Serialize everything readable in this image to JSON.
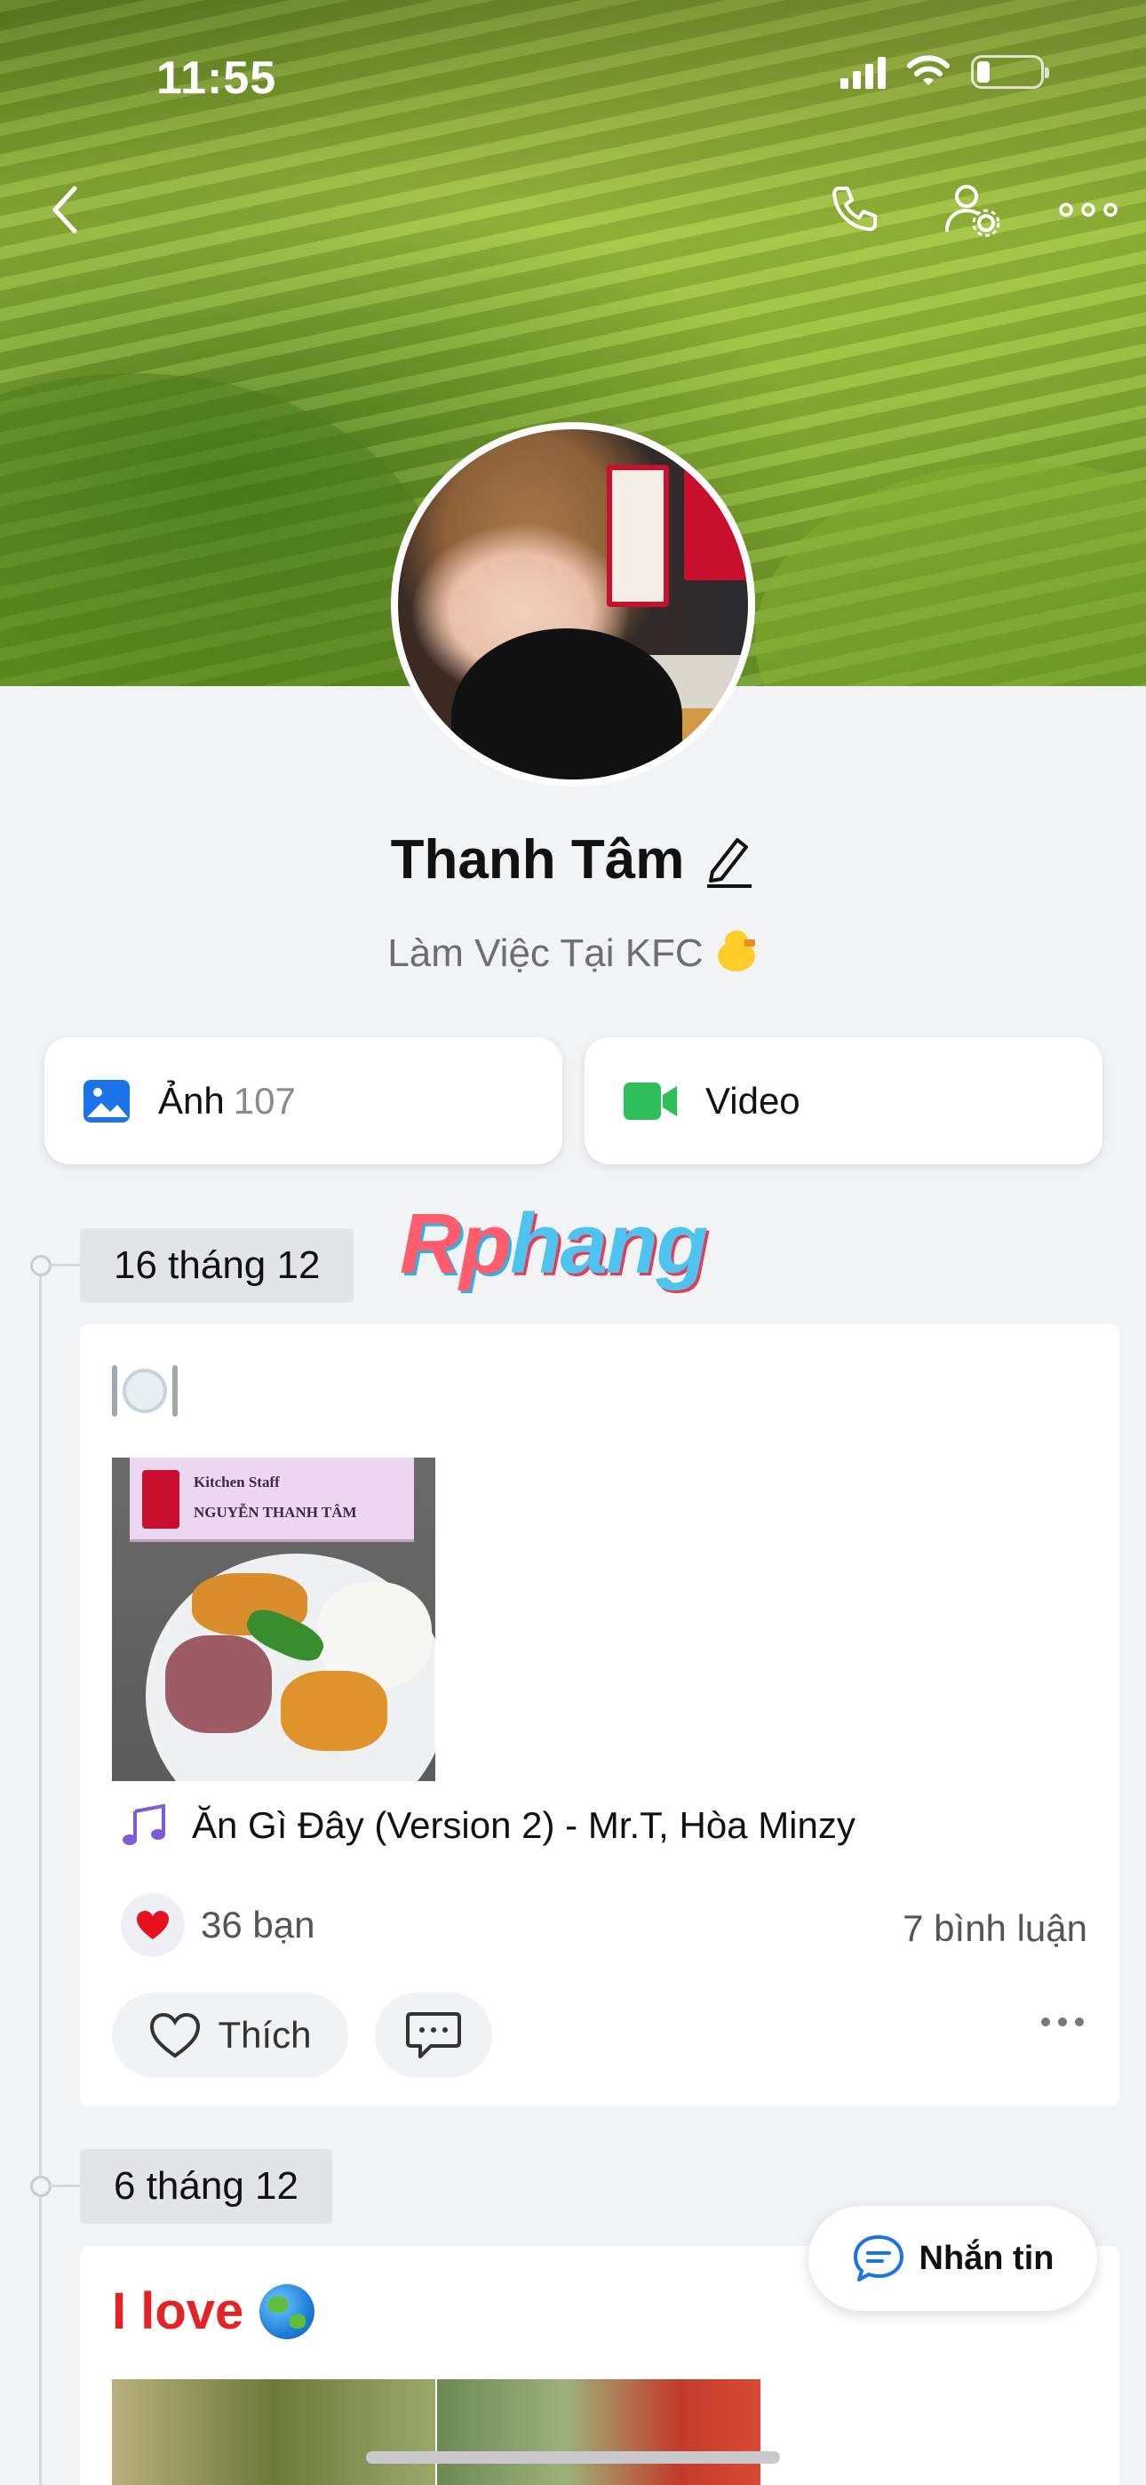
{
  "status_bar": {
    "time": "11:55"
  },
  "profile": {
    "name": "Thanh Tâm",
    "bio": "Làm Việc Tại KFC"
  },
  "media": {
    "photo_label": "Ảnh",
    "photo_count": "107",
    "video_label": "Video"
  },
  "watermark": {
    "part1": "Rp",
    "part2": "hang"
  },
  "posts": [
    {
      "date": "16 tháng 12",
      "photo_text": {
        "line1": "Kitchen Staff",
        "line2": "NGUYỄN THANH TÂM"
      },
      "music": "Ăn Gì Đây (Version 2) - Mr.T, Hòa Minzy",
      "likes": "36 bạn",
      "comments": "7 bình luận",
      "like_label": "Thích"
    },
    {
      "date": "6 tháng 12",
      "text": "I love"
    }
  ],
  "message_button": {
    "label": "Nhắn tin"
  },
  "colors": {
    "accent_red": "#e32424",
    "kfc_red": "#c8102e",
    "message_blue": "#1a73e8"
  }
}
